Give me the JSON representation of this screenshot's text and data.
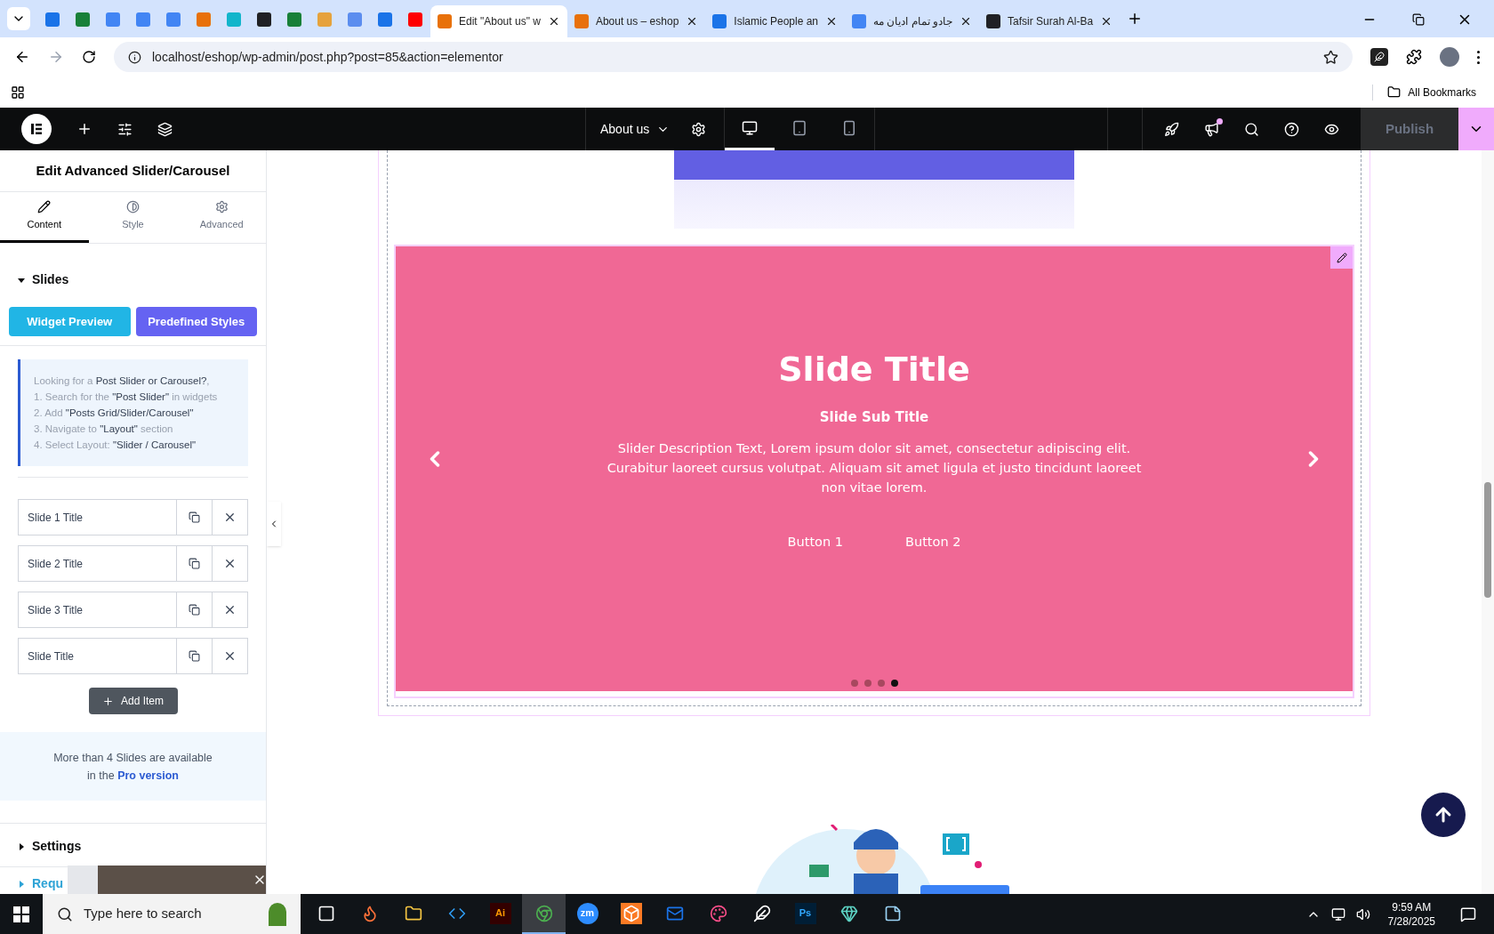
{
  "browser": {
    "tabs": [
      {
        "kind": "icon",
        "color": "#1a73e8",
        "selected": false
      },
      {
        "kind": "icon",
        "color": "#188038",
        "selected": false
      },
      {
        "kind": "icon",
        "color": "#4285f4",
        "selected": false
      },
      {
        "kind": "icon",
        "color": "#4285f4",
        "selected": false
      },
      {
        "kind": "icon",
        "color": "#4285f4",
        "selected": false
      },
      {
        "kind": "icon",
        "color": "#e8710a",
        "selected": false
      },
      {
        "kind": "icon",
        "color": "#12b5cb",
        "selected": false
      },
      {
        "kind": "icon",
        "color": "#202124",
        "selected": false
      },
      {
        "kind": "icon",
        "color": "#188038",
        "selected": false
      },
      {
        "kind": "icon",
        "color": "#e6a23c",
        "selected": false
      },
      {
        "kind": "icon",
        "color": "#5b8def",
        "selected": false
      },
      {
        "kind": "icon",
        "color": "#1a73e8",
        "selected": false
      },
      {
        "kind": "icon",
        "color": "#ff0000",
        "selected": false
      },
      {
        "kind": "titled",
        "title": "Edit \"About us\" w",
        "color": "#e8710a",
        "selected": true
      },
      {
        "kind": "titled",
        "title": "About us – eshop",
        "color": "#e8710a",
        "selected": false
      },
      {
        "kind": "titled",
        "title": "Islamic People an",
        "color": "#1a73e8",
        "selected": false
      },
      {
        "kind": "titled",
        "title": "جادو تمام ادیان مه",
        "color": "#4285f4",
        "selected": false
      },
      {
        "kind": "titled",
        "title": "Tafsir Surah Al-Ba",
        "color": "#202124",
        "selected": false
      }
    ],
    "url": "localhost/eshop/wp-admin/post.php?post=85&action=elementor",
    "bookmarks_label": "All Bookmarks"
  },
  "editor_bar": {
    "page_title": "About us",
    "devices": [
      {
        "kind": "desktop",
        "selected": true
      },
      {
        "kind": "tablet",
        "selected": false
      },
      {
        "kind": "mobile",
        "selected": false
      }
    ],
    "notification": true,
    "publish": {
      "label": "Publish",
      "disabled": true
    }
  },
  "panel": {
    "title": "Edit Advanced Slider/Carousel",
    "tabs": [
      {
        "kind": "content",
        "label": "Content",
        "selected": true
      },
      {
        "kind": "style",
        "label": "Style",
        "selected": false
      },
      {
        "kind": "advanced",
        "label": "Advanced",
        "selected": false
      }
    ],
    "sections": [
      {
        "title": "Slides",
        "expanded": true
      },
      {
        "title": "Settings",
        "expanded": false
      },
      {
        "title": "Requ",
        "expanded": false
      }
    ],
    "buttons": [
      "Widget Preview",
      "Predefined Styles"
    ],
    "notice": [
      "Looking for a **Post Slider or Carousel?**,",
      "1. Search for the **\"Post Slider\"** in widgets",
      "2. Add **\"Posts Grid/Slider/Carousel\"**",
      "3. Navigate to **\"Layout\"** section",
      "4. Select Layout: **\"Slider / Carousel\"**"
    ],
    "slides": [
      "Slide 1 Title",
      "Slide 2 Title",
      "Slide 3 Title",
      "Slide Title"
    ],
    "add_item": "Add Item",
    "pro_notice": {
      "line1": "More than 4 Slides are available",
      "line2": "in the",
      "link": "Pro version"
    }
  },
  "slider": {
    "title": "Slide Title",
    "subtitle": "Slide Sub Title",
    "description": "Slider Description Text, Lorem ipsum dolor sit amet, consectetur adipiscing elit. Curabitur laoreet cursus volutpat. Aliquam sit amet ligula et justo tincidunt laoreet non vitae lorem.",
    "buttons": [
      "Button 1",
      "Button 2"
    ],
    "dots": [
      {
        "selected": false
      },
      {
        "selected": false
      },
      {
        "selected": false
      },
      {
        "selected": true
      }
    ]
  },
  "taskbar": {
    "search_placeholder": "Type here to search",
    "apps": [
      {
        "kind": "taskview",
        "selected": false
      },
      {
        "kind": "firefox",
        "selected": false
      },
      {
        "kind": "folder",
        "selected": false
      },
      {
        "kind": "vscode",
        "selected": false
      },
      {
        "kind": "illustrator",
        "label": "Ai",
        "selected": false
      },
      {
        "kind": "chrome",
        "selected": true
      },
      {
        "kind": "zoom",
        "label": "zm",
        "selected": false
      },
      {
        "kind": "xampp",
        "selected": false
      },
      {
        "kind": "outlook",
        "selected": false
      },
      {
        "kind": "creative",
        "selected": false
      },
      {
        "kind": "pen",
        "selected": false
      },
      {
        "kind": "photoshop",
        "label": "Ps",
        "selected": false
      },
      {
        "kind": "gem",
        "selected": false
      },
      {
        "kind": "notes",
        "selected": false
      }
    ],
    "time": "9:59 AM",
    "date": "7/28/2025"
  }
}
